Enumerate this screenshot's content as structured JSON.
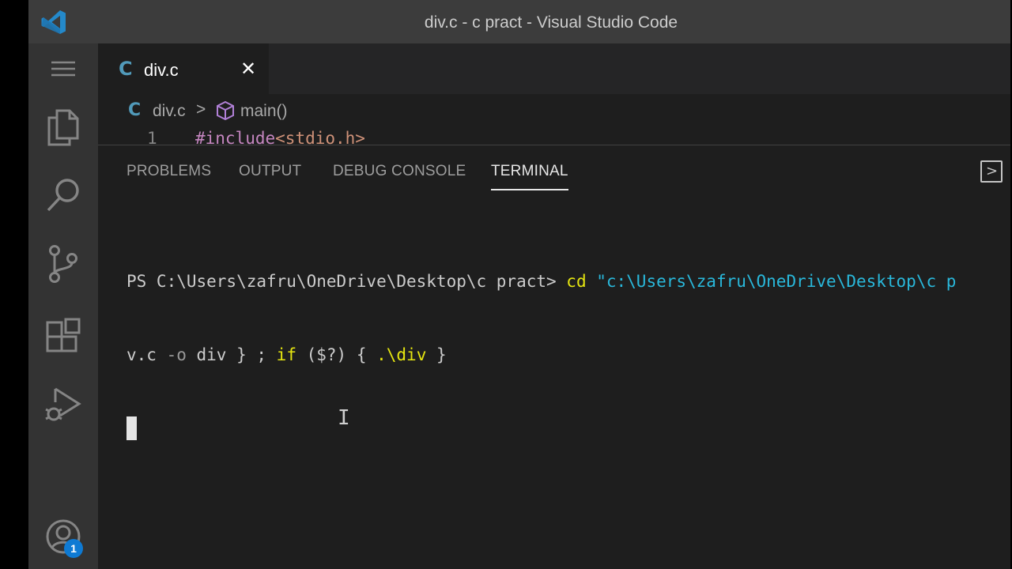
{
  "window": {
    "title": "div.c - c pract - Visual Studio Code"
  },
  "activity_bar": {
    "items": [
      {
        "name": "menu",
        "icon": "hamburger-menu-icon"
      },
      {
        "name": "explorer",
        "icon": "files-icon"
      },
      {
        "name": "search",
        "icon": "search-icon"
      },
      {
        "name": "source-control",
        "icon": "source-control-icon"
      },
      {
        "name": "extensions",
        "icon": "extensions-icon"
      },
      {
        "name": "run-debug",
        "icon": "run-debug-icon"
      }
    ],
    "accounts": {
      "icon": "account-icon",
      "badge": "1"
    }
  },
  "editor": {
    "tab": {
      "icon": "C",
      "label": "div.c",
      "close": "✕"
    },
    "breadcrumb": {
      "icon": "C",
      "file": "div.c",
      "separator": ">",
      "symbol_icon": "cube-icon",
      "symbol": "main()"
    },
    "code": [
      {
        "line": "1",
        "directive": "#include",
        "arg": "<stdio.h>"
      }
    ]
  },
  "panel": {
    "tabs": [
      {
        "label": "PROBLEMS",
        "active": false
      },
      {
        "label": "OUTPUT",
        "active": false
      },
      {
        "label": "DEBUG CONSOLE",
        "active": false
      },
      {
        "label": "TERMINAL",
        "active": true
      }
    ],
    "terminal": {
      "prompt": "PS C:\\Users\\zafru\\OneDrive\\Desktop\\c pract> ",
      "cmd": "cd",
      "path": " \"c:\\Users\\zafru\\OneDrive\\Desktop\\c p",
      "line2_a": "v.c ",
      "line2_b": "-o",
      "line2_c": " div } ; ",
      "line2_d": "if",
      "line2_e": " ($?) { ",
      "line2_f": ".\\div",
      "line2_g": " }"
    }
  },
  "colors": {
    "accent": "#0e7ad3",
    "c_icon": "#519aba",
    "terminal_cmd": "#e5e510",
    "terminal_string": "#29b8db"
  }
}
